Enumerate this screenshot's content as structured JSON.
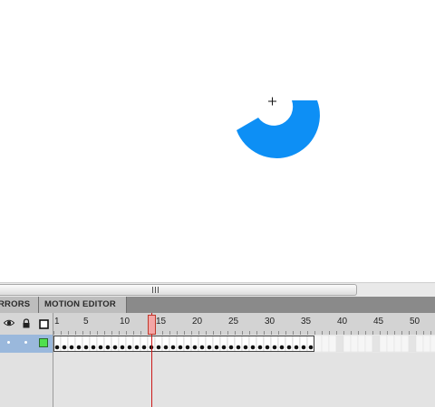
{
  "stage": {
    "shape_color": "#0d8ff5",
    "crosshair_symbol": "+"
  },
  "panel_tabs": {
    "errors_label": "RRORS",
    "motion_editor_label": "MOTION EDITOR"
  },
  "timeline": {
    "frame_numbers": [
      "1",
      "5",
      "10",
      "15",
      "20",
      "25",
      "30",
      "35",
      "40",
      "45",
      "50"
    ],
    "current_frame": 14,
    "last_filled_frame": 36,
    "layer": {
      "outline_color": "#4fe04f",
      "selected_color": "#9ab8dc"
    },
    "playhead_color": "#cc1a1a"
  }
}
